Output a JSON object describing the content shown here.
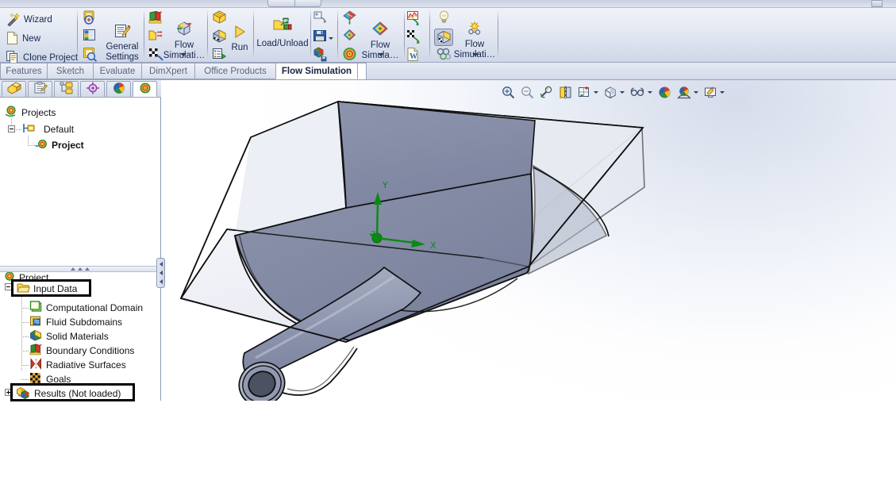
{
  "app": {
    "active_tab": "Flow Simulation"
  },
  "ribbon": {
    "groups": [
      {
        "name": "project",
        "commands": [
          {
            "label": "Wizard",
            "icon": "wand-icon"
          },
          {
            "label": "New",
            "icon": "new-document-icon"
          },
          {
            "label": "Clone Project",
            "icon": "clone-project-icon"
          }
        ]
      },
      {
        "name": "general-settings",
        "commands": [
          {
            "label": "General\nSettings",
            "line1": "General",
            "line2": "Settings",
            "icon": "general-settings-icon"
          }
        ],
        "icon_stack": [
          "project-zoom-icon",
          "units-table-icon",
          "project-search-icon"
        ]
      },
      {
        "name": "flow-simulation-tools",
        "commands": [
          {
            "line1": "Flow",
            "line2": "Simulati…",
            "icon": "flow-simulation-tools-icon"
          }
        ],
        "icon_stack": [
          "boundary-condition-icon",
          "folder-arrow-icon",
          "goals-flag-icon"
        ]
      },
      {
        "name": "run",
        "commands": [
          {
            "label": "Run",
            "icon": "run-play-icon"
          }
        ],
        "icon_stack": [
          "mesh-grid-icon",
          "mesh-solid-icon",
          "solver-list-icon"
        ]
      },
      {
        "name": "results-load",
        "commands": [
          {
            "label": "Load/Unload",
            "icon": "load-unload-icon"
          }
        ]
      },
      {
        "name": "results-save",
        "icon_stack": [
          "batch-results-icon",
          "save-results-icon",
          "export-results-icon"
        ]
      },
      {
        "name": "flow-simulation-results",
        "commands": [
          {
            "line1": "Flow",
            "line2": "Simula…",
            "icon": "results-surface-plot-icon"
          }
        ],
        "icon_stack": [
          "cut-plot-icon",
          "surface-plot-icon",
          "flow-trajectories-icon"
        ]
      },
      {
        "name": "results-reports",
        "icon_stack": [
          "xy-plot-icon",
          "goal-plot-icon",
          "report-word-icon"
        ]
      },
      {
        "name": "flow-simulation-display",
        "commands": [
          {
            "line1": "Flow",
            "line2": "Simulati…",
            "icon": "flow-sim-display-icon"
          }
        ],
        "icon_stack": [
          "light-bulb-icon",
          "display-model-icon",
          "display-geometry-icon"
        ],
        "pressed_icon": "display-model-icon"
      }
    ]
  },
  "command_tabs": [
    {
      "label": "Features",
      "active": false
    },
    {
      "label": "Sketch",
      "active": false
    },
    {
      "label": "Evaluate",
      "active": false
    },
    {
      "label": "DimXpert",
      "active": false
    },
    {
      "label": "Office Products",
      "active": false
    },
    {
      "label": "Flow Simulation",
      "active": true
    }
  ],
  "manager_tabs": [
    {
      "name": "feature-manager-tab",
      "icon": "feature-manager-icon",
      "active": false
    },
    {
      "name": "property-manager-tab",
      "icon": "property-manager-icon",
      "active": false
    },
    {
      "name": "configuration-manager-tab",
      "icon": "configuration-manager-icon",
      "active": false
    },
    {
      "name": "dimxpert-manager-tab",
      "icon": "dimxpert-target-icon",
      "active": false
    },
    {
      "name": "display-manager-tab",
      "icon": "display-manager-sphere-icon",
      "active": false
    },
    {
      "name": "flow-simulation-manager-tab",
      "icon": "flow-simulation-tree-icon",
      "active": true
    }
  ],
  "project_tree": {
    "root": {
      "label": "Projects",
      "icon": "projects-icon"
    },
    "config": {
      "label": "Default",
      "icon": "configuration-icon"
    },
    "project": {
      "label": "Project",
      "icon": "project-icon",
      "bold": true
    }
  },
  "analysis_tree": {
    "root": {
      "label": "Project",
      "icon": "project-icon"
    },
    "input_data": {
      "label": "Input Data",
      "icon": "input-data-folder-icon",
      "highlighted": true
    },
    "children": [
      {
        "label": "Computational Domain",
        "icon": "computational-domain-icon"
      },
      {
        "label": "Fluid Subdomains",
        "icon": "fluid-subdomains-icon"
      },
      {
        "label": "Solid Materials",
        "icon": "solid-materials-icon"
      },
      {
        "label": "Boundary Conditions",
        "icon": "boundary-conditions-icon"
      },
      {
        "label": "Radiative Surfaces",
        "icon": "radiative-surfaces-icon"
      },
      {
        "label": "Goals",
        "icon": "goals-icon"
      }
    ],
    "results": {
      "label": "Results (Not loaded)",
      "icon": "results-icon",
      "highlighted": true
    }
  },
  "view_toolbar": [
    {
      "name": "zoom-to-fit-button",
      "icon": "zoom-to-fit-icon",
      "dropdown": false
    },
    {
      "name": "zoom-to-area-button",
      "icon": "zoom-to-area-icon",
      "dropdown": false
    },
    {
      "name": "previous-view-button",
      "icon": "previous-view-icon",
      "dropdown": false
    },
    {
      "name": "section-view-button",
      "icon": "section-view-icon",
      "dropdown": false
    },
    {
      "name": "view-orientation-button",
      "icon": "view-orientation-icon",
      "dropdown": true
    },
    {
      "name": "display-style-button",
      "icon": "display-style-icon",
      "dropdown": true
    },
    {
      "name": "hide-show-items-button",
      "icon": "hide-show-glasses-icon",
      "dropdown": true
    },
    {
      "name": "edit-appearance-button",
      "icon": "appearance-sphere-icon",
      "dropdown": false
    },
    {
      "name": "apply-scene-button",
      "icon": "apply-scene-icon",
      "dropdown": true
    },
    {
      "name": "view-settings-button",
      "icon": "view-settings-icon",
      "dropdown": true
    }
  ],
  "model": {
    "triad": {
      "x_label": "X",
      "y_label": "Y",
      "z_label": "Z",
      "color": "#0a8a14"
    },
    "description": "Transparent rectangular duct enclosure with an internal curved sheet and a horizontal cylindrical tube"
  },
  "colors": {
    "ribbon_top": "#f3f5fa",
    "ribbon_bottom": "#cfd7e8",
    "tab_active_bg": "#ffffff",
    "tree_text": "#111111",
    "highlight_border": "#000000",
    "triad_green": "#0a8a14",
    "model_face_dark": "#7f86a0",
    "model_face_light": "#aeb5c8",
    "viewport_bg": "#ffffff"
  }
}
